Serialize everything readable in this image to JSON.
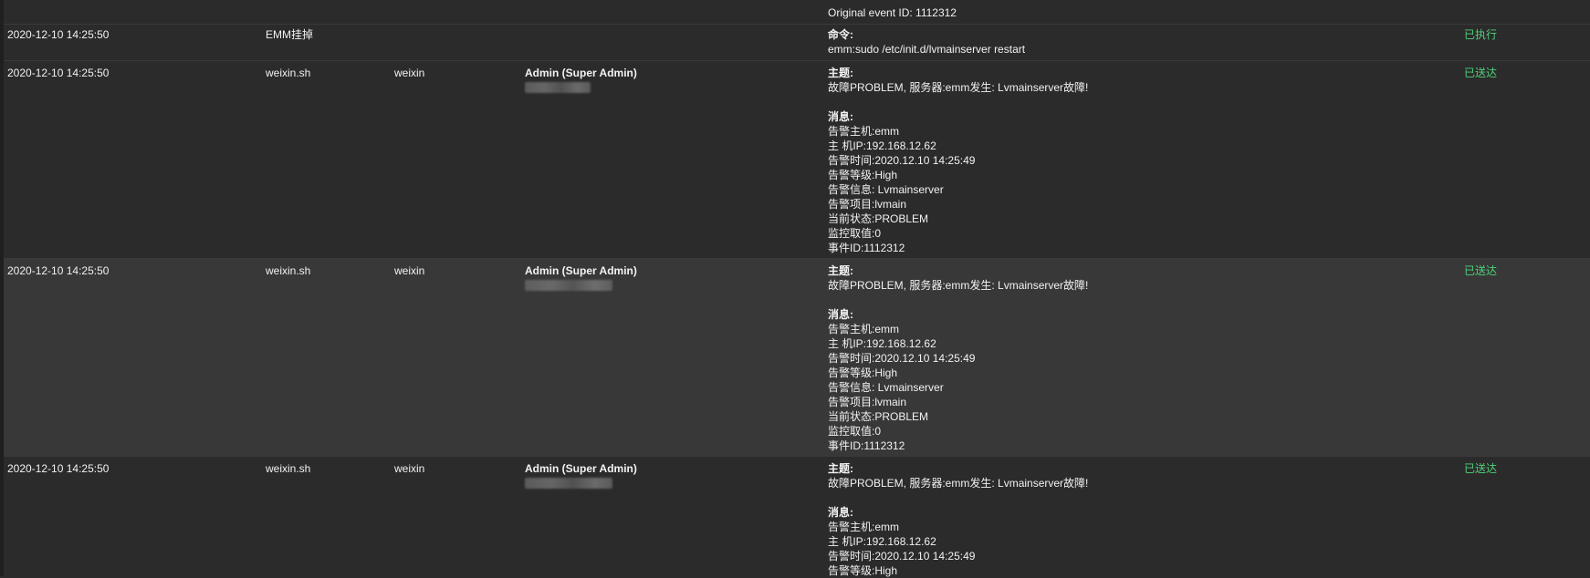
{
  "rows": [
    {
      "partial_message": "Original event ID: 1112312"
    },
    {
      "time": "2020-12-10 14:25:50",
      "action": "EMM挂掉",
      "message_title_label": "命令:",
      "command": "emm:sudo /etc/init.d/lvmainserver restart",
      "status": "已执行"
    },
    {
      "time": "2020-12-10 14:25:50",
      "action": "weixin.sh",
      "type": "weixin",
      "recipient": "Admin (Super Admin)",
      "subject_label": "主题:",
      "subject": "故障PROBLEM, 服务器:emm发生: Lvmainserver故障!",
      "message_label": "消息:",
      "message_lines": [
        "告警主机:emm",
        "主 机IP:192.168.12.62",
        "告警时间:2020.12.10 14:25:49",
        "告警等级:High",
        "告警信息: Lvmainserver",
        "告警项目:lvmain",
        "当前状态:PROBLEM",
        "监控取值:0",
        "事件ID:1112312"
      ],
      "status": "已送达"
    },
    {
      "time": "2020-12-10 14:25:50",
      "action": "weixin.sh",
      "type": "weixin",
      "recipient": "Admin (Super Admin)",
      "subject_label": "主题:",
      "subject": "故障PROBLEM, 服务器:emm发生: Lvmainserver故障!",
      "message_label": "消息:",
      "message_lines": [
        "告警主机:emm",
        "主 机IP:192.168.12.62",
        "告警时间:2020.12.10 14:25:49",
        "告警等级:High",
        "告警信息: Lvmainserver",
        "告警项目:lvmain",
        "当前状态:PROBLEM",
        "监控取值:0",
        "事件ID:1112312"
      ],
      "status": "已送达"
    },
    {
      "time": "2020-12-10 14:25:50",
      "action": "weixin.sh",
      "type": "weixin",
      "recipient": "Admin (Super Admin)",
      "subject_label": "主题:",
      "subject": "故障PROBLEM, 服务器:emm发生: Lvmainserver故障!",
      "message_label": "消息:",
      "message_lines": [
        "告警主机:emm",
        "主 机IP:192.168.12.62",
        "告警时间:2020.12.10 14:25:49",
        "告警等级:High"
      ],
      "status": "已送达"
    }
  ]
}
